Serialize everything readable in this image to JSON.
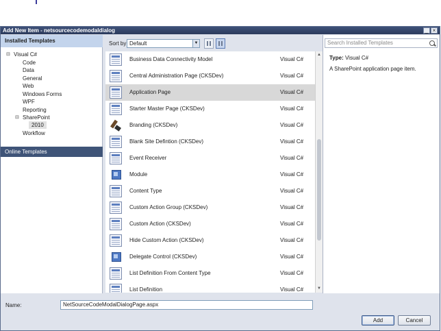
{
  "window": {
    "title": "Add New Item - netsourcecodemodaldialog",
    "minimize": "_",
    "close": "×"
  },
  "left": {
    "header": "Installed Templates",
    "tree": [
      {
        "label": "Visual C#",
        "expander": "⊟"
      },
      {
        "label": "Code"
      },
      {
        "label": "Data"
      },
      {
        "label": "General"
      },
      {
        "label": "Web"
      },
      {
        "label": "Windows Forms"
      },
      {
        "label": "WPF"
      },
      {
        "label": "Reporting"
      },
      {
        "label": "SharePoint",
        "expander": "⊟"
      },
      {
        "label": "2010"
      },
      {
        "label": "Workflow"
      }
    ],
    "online": "Online Templates"
  },
  "toolbar": {
    "sort_label": "Sort by:",
    "sort_value": "Default"
  },
  "templates": [
    {
      "name": "Business Data Connectivity Model",
      "lang": "Visual C#",
      "icon": "page-icon"
    },
    {
      "name": "Central Administration Page (CKSDev)",
      "lang": "Visual C#",
      "icon": "page-icon"
    },
    {
      "name": "Application Page",
      "lang": "Visual C#",
      "icon": "page-icon"
    },
    {
      "name": "Starter Master Page (CKSDev)",
      "lang": "Visual C#",
      "icon": "page-icon"
    },
    {
      "name": "Branding (CKSDev)",
      "lang": "Visual C#",
      "icon": "brush-icon"
    },
    {
      "name": "Blank Site Defintion (CKSDev)",
      "lang": "Visual C#",
      "icon": "site-icon"
    },
    {
      "name": "Event Receiver",
      "lang": "Visual C#",
      "icon": "event-icon"
    },
    {
      "name": "Module",
      "lang": "Visual C#",
      "icon": "module-icon"
    },
    {
      "name": "Content Type",
      "lang": "Visual C#",
      "icon": "content-type-icon"
    },
    {
      "name": "Custom Action Group (CKSDev)",
      "lang": "Visual C#",
      "icon": "page-icon"
    },
    {
      "name": "Custom Action (CKSDev)",
      "lang": "Visual C#",
      "icon": "page-icon"
    },
    {
      "name": "Hide Custom Action (CKSDev)",
      "lang": "Visual C#",
      "icon": "page-icon"
    },
    {
      "name": "Delegate Control (CKSDev)",
      "lang": "Visual C#",
      "icon": "cube-icon"
    },
    {
      "name": "List Definition From Content Type",
      "lang": "Visual C#",
      "icon": "page-icon"
    },
    {
      "name": "List Definition",
      "lang": "Visual C#",
      "icon": "page-icon"
    }
  ],
  "selected_template": "Application Page",
  "right": {
    "search_placeholder": "Search Installed Templates",
    "type_label": "Type:",
    "type_value": "Visual C#",
    "description": "A SharePoint application page item."
  },
  "bottom": {
    "name_label": "Name:",
    "name_value": "NetSourceCodeModalDialogPage.aspx",
    "add_label": "Add",
    "cancel_label": "Cancel"
  }
}
